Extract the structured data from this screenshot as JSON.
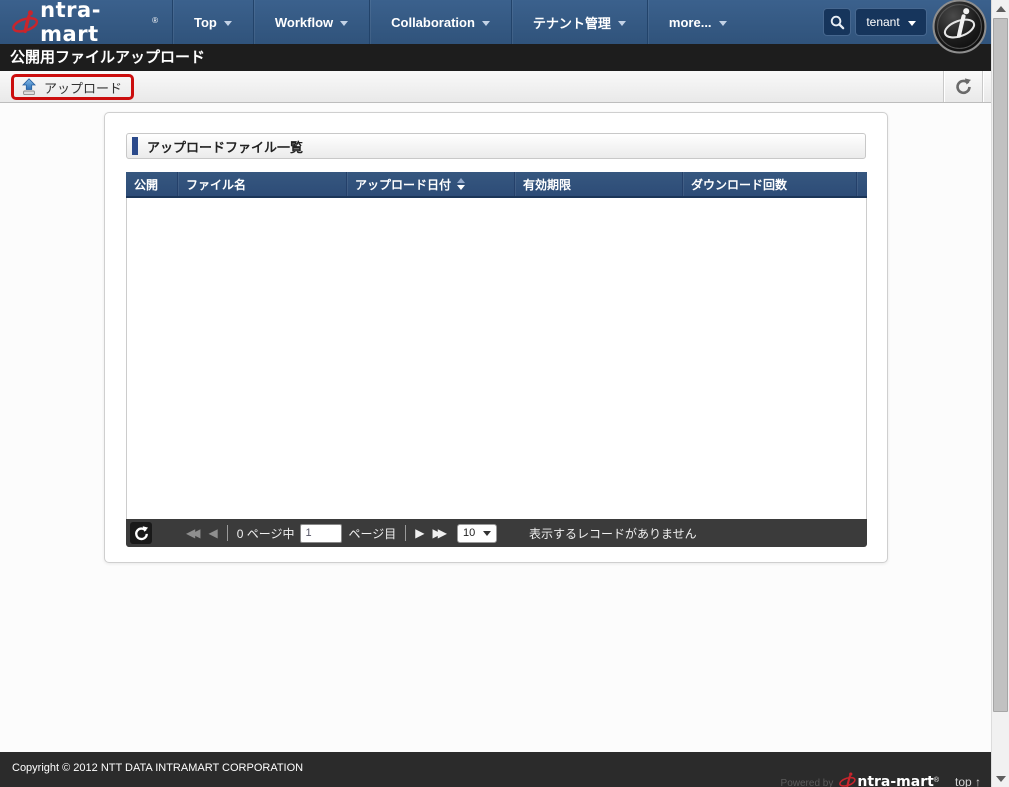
{
  "nav": {
    "brand_rest": "ntra-mart",
    "brand_reg": "®",
    "items": [
      {
        "label": "Top"
      },
      {
        "label": "Workflow"
      },
      {
        "label": "Collaboration"
      },
      {
        "label": "テナント管理"
      },
      {
        "label": "more..."
      }
    ],
    "account_label": "tenant"
  },
  "page": {
    "title": "公開用ファイルアップロード"
  },
  "toolbar": {
    "upload_label": "アップロード"
  },
  "panel": {
    "title": "アップロードファイル一覧"
  },
  "table": {
    "columns": [
      {
        "label": "公開"
      },
      {
        "label": "ファイル名"
      },
      {
        "label": "アップロード日付",
        "sorted": "desc"
      },
      {
        "label": "有効期限"
      },
      {
        "label": "ダウンロード回数"
      }
    ],
    "rows": []
  },
  "pagination": {
    "total_label": "0 ページ中",
    "page_value": "1",
    "unit_label": "ページ目",
    "page_size": "10",
    "empty_message": "表示するレコードがありません"
  },
  "footer": {
    "copyright": "Copyright © 2012 NTT DATA INTRAMART CORPORATION",
    "powered_by": "Powered by",
    "brand_rest": "ntra-mart",
    "brand_reg": "®",
    "top_link": "top ↑"
  },
  "colors": {
    "nav_blue": "#33567d",
    "table_header_blue": "#30507e",
    "annotation_red": "#cb0e0e",
    "pagination_dark": "#3b3b3b",
    "footer_dark": "#2b2b2b",
    "brand_red": "#c9252c"
  }
}
